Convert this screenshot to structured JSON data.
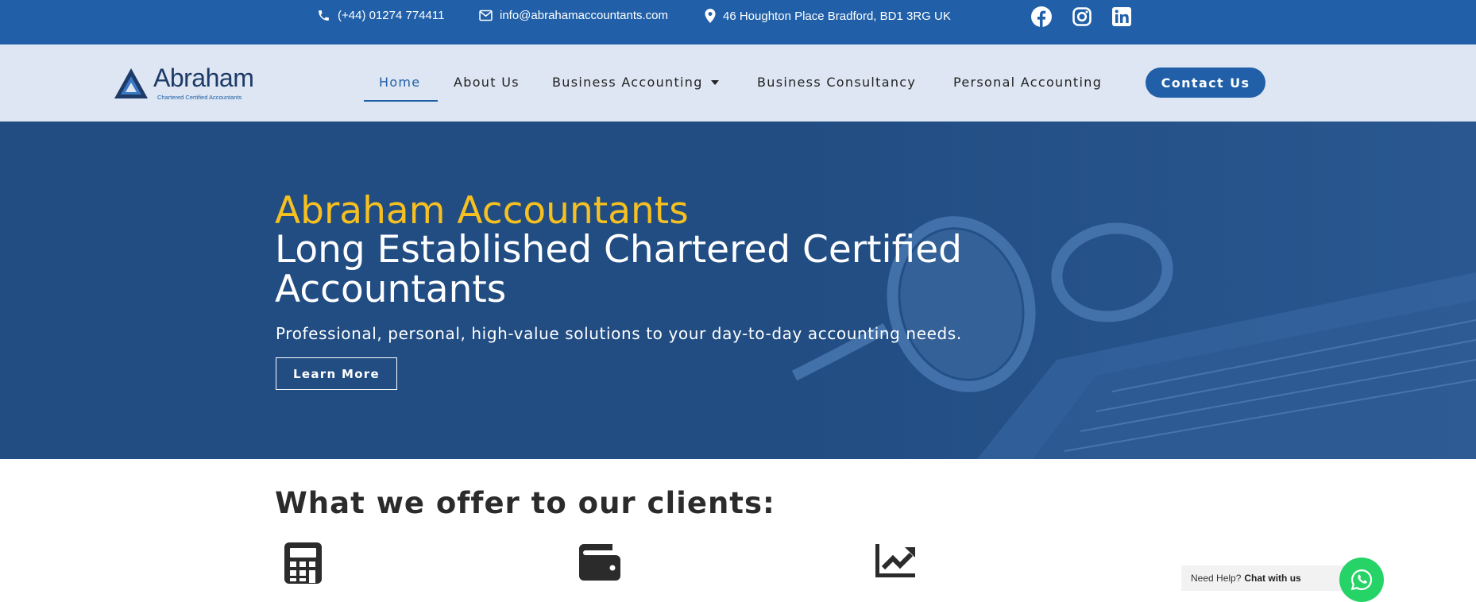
{
  "topbar": {
    "phone": "(+44) 01274 774411",
    "email": "info@abrahamaccountants.com",
    "address": "46 Houghton Place Bradford, BD1 3RG UK",
    "social": [
      "facebook-icon",
      "instagram-icon",
      "linkedin-icon"
    ]
  },
  "logo": {
    "name": "Abraham",
    "tagline": "Chartered Certified Accountants"
  },
  "nav": {
    "items": [
      {
        "label": "Home",
        "active": true
      },
      {
        "label": "About Us"
      },
      {
        "label": "Business Accounting",
        "dropdown": true
      },
      {
        "label": "Business Consultancy"
      },
      {
        "label": "Personal Accounting"
      }
    ],
    "cta": "Contact Us"
  },
  "hero": {
    "kicker": "Abraham Accountants",
    "title": "Long Established Chartered Certified Accountants",
    "subtitle": "Professional, personal, high-value solutions to your day-to-day accounting needs.",
    "button": "Learn More"
  },
  "offer": {
    "heading": "What we offer to our clients:",
    "icons": [
      "calculator-icon",
      "wallet-icon",
      "chart-line-icon"
    ]
  },
  "chat": {
    "prompt": "Need Help?",
    "action": "Chat with us"
  },
  "colors": {
    "brand": "#2160a8",
    "hero_bg": "#214d83",
    "accent": "#f5c020",
    "nav_bg": "#dde6f2",
    "whatsapp": "#25d366"
  }
}
